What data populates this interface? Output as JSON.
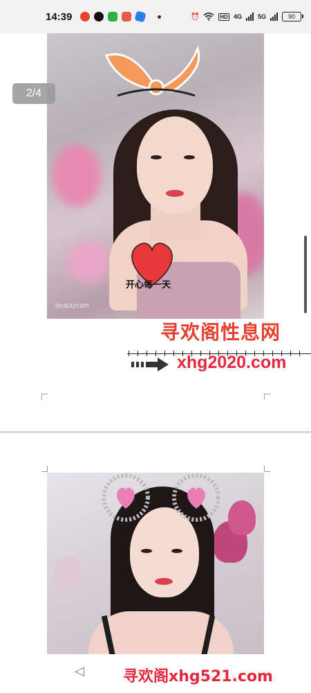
{
  "status_bar": {
    "time": "14:39",
    "network_hd": "HD",
    "signal1_label": "4G",
    "signal2_label": "5G",
    "battery": "90"
  },
  "viewer": {
    "page_indicator": "2/4",
    "photo1_caption": "开心每一天",
    "photo1_small_watermark": "beautycam"
  },
  "watermark": {
    "title": "寻欢阁性息网",
    "url": "xhg2020.com"
  },
  "bottom_bar": {
    "back_glyph": "◁",
    "watermark": "寻欢阁xhg521.com"
  },
  "colors": {
    "watermark_red": "#e5283e",
    "status_bg": "#f1f1f1",
    "page_indicator_bg": "#9c9c9c"
  }
}
